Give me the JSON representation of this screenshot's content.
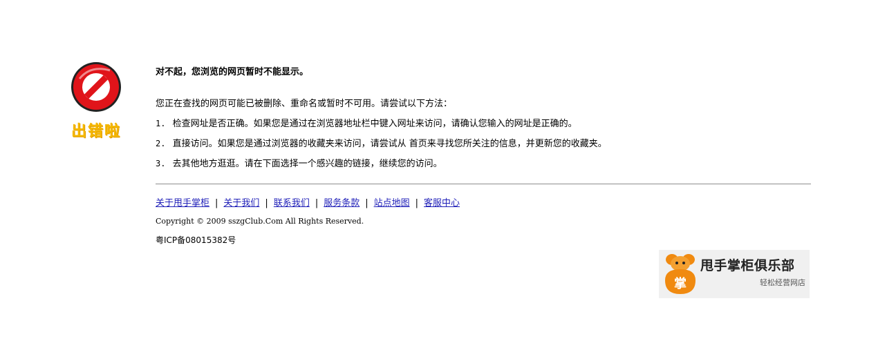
{
  "error": {
    "badge_text": "出错啦",
    "headline": "对不起，您浏览的网页暂时不能显示。",
    "intro": "您正在查找的网页可能已被删除、重命名或暂时不可用。请尝试以下方法：",
    "steps": [
      {
        "num": "1.",
        "text": "检查网址是否正确。如果您是通过在浏览器地址栏中键入网址来访问，请确认您输入的网址是正确的。"
      },
      {
        "num": "2.",
        "text": "直接访问。如果您是通过浏览器的收藏夹来访问，请尝试从 首页来寻找您所关注的信息，并更新您的收藏夹。"
      },
      {
        "num": "3.",
        "text": "去其他地方逛逛。请在下面选择一个感兴趣的链接，继续您的访问。"
      }
    ]
  },
  "footer": {
    "links": [
      {
        "label": "关于甩手掌柜"
      },
      {
        "label": "关于我们"
      },
      {
        "label": "联系我们"
      },
      {
        "label": "服务条款"
      },
      {
        "label": "站点地图"
      },
      {
        "label": "客服中心"
      }
    ],
    "separator": "|",
    "copyright": "Copyright © 2009 sszgClub.Com All Rights Reserved.",
    "icp": "粤ICP备08015382号"
  },
  "brand": {
    "mascot_char": "掌",
    "name": "甩手掌柜俱乐部",
    "tagline": "轻松经营网店"
  },
  "colors": {
    "stop_red": "#e0141a",
    "badge_yellow": "#f5b800",
    "link": "#1f1fb8",
    "mascot_orange": "#f08a10"
  }
}
